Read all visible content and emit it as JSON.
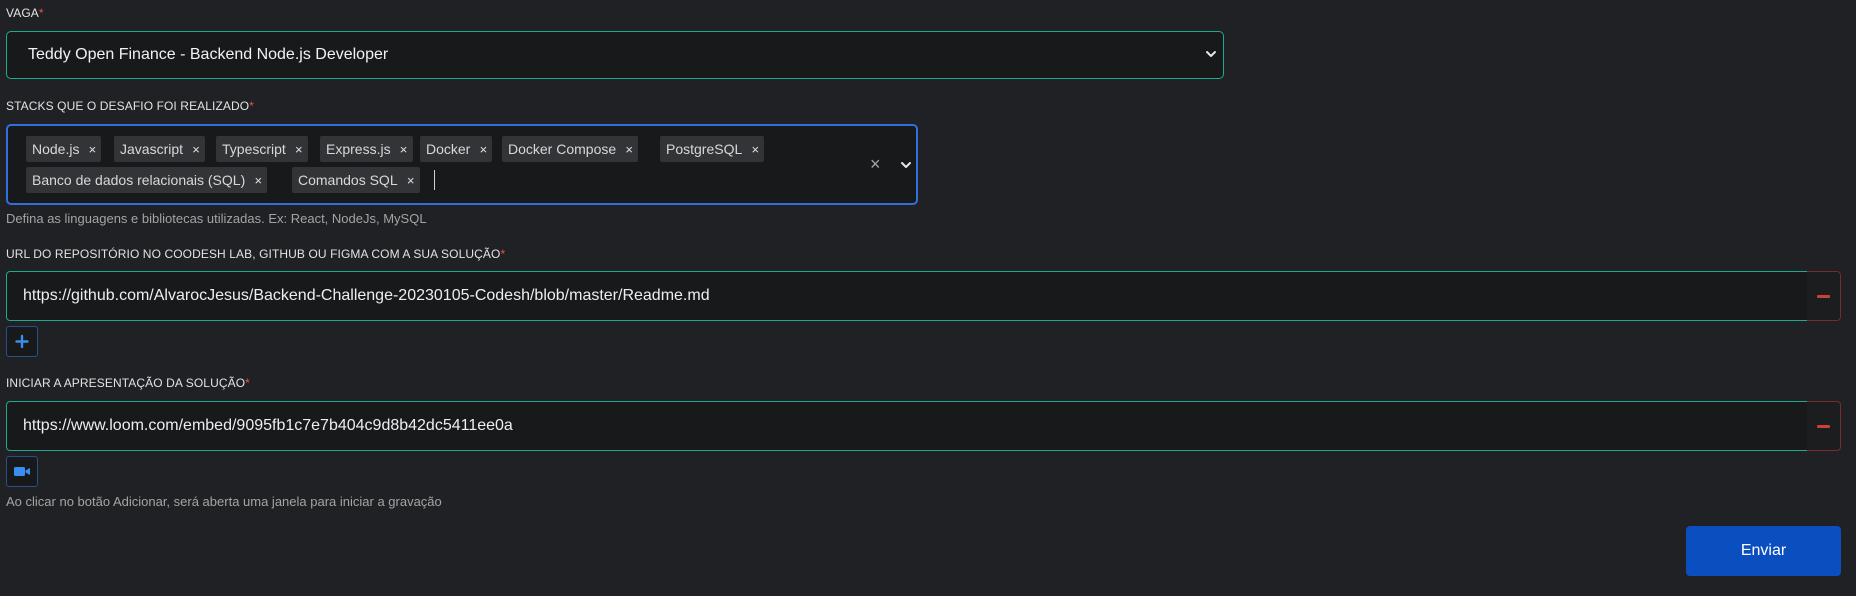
{
  "form": {
    "vaga": {
      "label": "VAGA",
      "required_mark": "*",
      "selected": "Teddy Open Finance - Backend Node.js Developer"
    },
    "stacks": {
      "label": "STACKS QUE O DESAFIO FOI REALIZADO",
      "required_mark": "*",
      "tags": [
        "Node.js",
        "Javascript",
        "Typescript",
        "Express.js",
        "Docker",
        "Docker Compose",
        "PostgreSQL",
        "Banco de dados relacionais (SQL)",
        "Comandos SQL"
      ],
      "tag_remove_glyph": "×",
      "clear_glyph": "×",
      "helper": "Defina as linguagens e bibliotecas utilizadas. Ex: React, NodeJs, MySQL"
    },
    "repo": {
      "label": "URL DO REPOSITÓRIO NO COODESH LAB, GITHUB OU FIGMA COM A SUA SOLUÇÃO",
      "required_mark": "*",
      "value": "https://github.com/AlvarocJesus/Backend-Challenge-20230105-Codesh/blob/master/Readme.md",
      "add_glyph": "+"
    },
    "presentation": {
      "label": "INICIAR A APRESENTAÇÃO DA SOLUÇÃO",
      "required_mark": "*",
      "value": "https://www.loom.com/embed/9095fb1c7e7b404c9d8b42dc5411ee0a",
      "helper": "Ao clicar no botão Adicionar, será aberta uma janela para iniciar a gravação"
    },
    "submit_label": "Enviar"
  },
  "icons": {
    "select_chevron": "chevron-down-icon",
    "multi_chevron": "chevron-down-icon",
    "clear": "close-icon",
    "remove": "minus-icon",
    "add": "plus-icon",
    "record": "video-camera-icon"
  },
  "colors": {
    "background": "#202124",
    "input_border": "#1fa98e",
    "focus_border": "#2f6fe0",
    "required": "#e8554e",
    "remove": "#c9413b",
    "primary_button": "#0b4ec0",
    "icon_blue": "#3b8df0"
  }
}
